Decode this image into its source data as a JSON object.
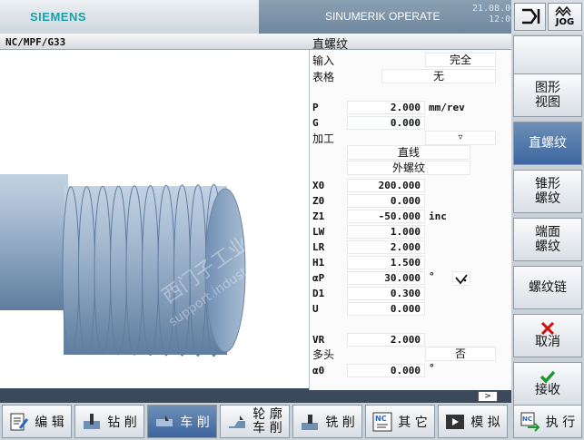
{
  "header": {
    "brand": "SIEMENS",
    "app_title": "SINUMERIK OPERATE",
    "date": "21.08.06",
    "time": "12:09",
    "jog_label": "JOG"
  },
  "path": "NC/MPF/G33",
  "form_title": "直螺纹",
  "form": {
    "input_label": "输入",
    "input_value": "完全",
    "table_label": "表格",
    "table_value": "无",
    "P_label": "P",
    "P_value": "2.000",
    "P_unit": "mm/rev",
    "G_label": "G",
    "G_value": "0.000",
    "machining_label": "加工",
    "machining_value": "▿",
    "type_value": "直线",
    "thread_value": "外螺纹",
    "X0_label": "X0",
    "X0_value": "200.000",
    "Z0_label": "Z0",
    "Z0_value": "0.000",
    "Z1_label": "Z1",
    "Z1_value": "-50.000",
    "Z1_unit": "inc",
    "LW_label": "LW",
    "LW_value": "1.000",
    "LR_label": "LR",
    "LR_value": "2.000",
    "H1_label": "H1",
    "H1_value": "1.500",
    "aP_label": "αP",
    "aP_value": "30.000",
    "aP_unit": "°",
    "D1_label": "D1",
    "D1_value": "0.300",
    "U_label": "U",
    "U_value": "0.000",
    "VR_label": "VR",
    "VR_value": "2.000",
    "multi_label": "多头",
    "multi_value": "否",
    "a0_label": "α0",
    "a0_value": "0.000",
    "a0_unit": "°"
  },
  "vertical_softkeys": [
    {
      "label": "图形\n视图"
    },
    {
      "label": "直螺纹"
    },
    {
      "label": "锥形\n螺纹"
    },
    {
      "label": "端面\n螺纹"
    },
    {
      "label": "螺纹链"
    },
    {
      "label": "取消"
    },
    {
      "label": "接收"
    }
  ],
  "horizontal_softkeys": [
    {
      "label": "编 辑"
    },
    {
      "label": "钻 削"
    },
    {
      "label": "车 削"
    },
    {
      "label": "轮 廓\n车 削"
    },
    {
      "label": "铣 削"
    },
    {
      "label": "其 它"
    },
    {
      "label": "模 拟"
    },
    {
      "label": "执 行"
    }
  ],
  "scroll_label": ">",
  "watermark": "西门子工业 技术论坛 support.industry.siemens.com",
  "colors": {
    "brand": "#17a1a9",
    "active_key": "#3d66a0",
    "part_fill": "#7f9bbb"
  }
}
